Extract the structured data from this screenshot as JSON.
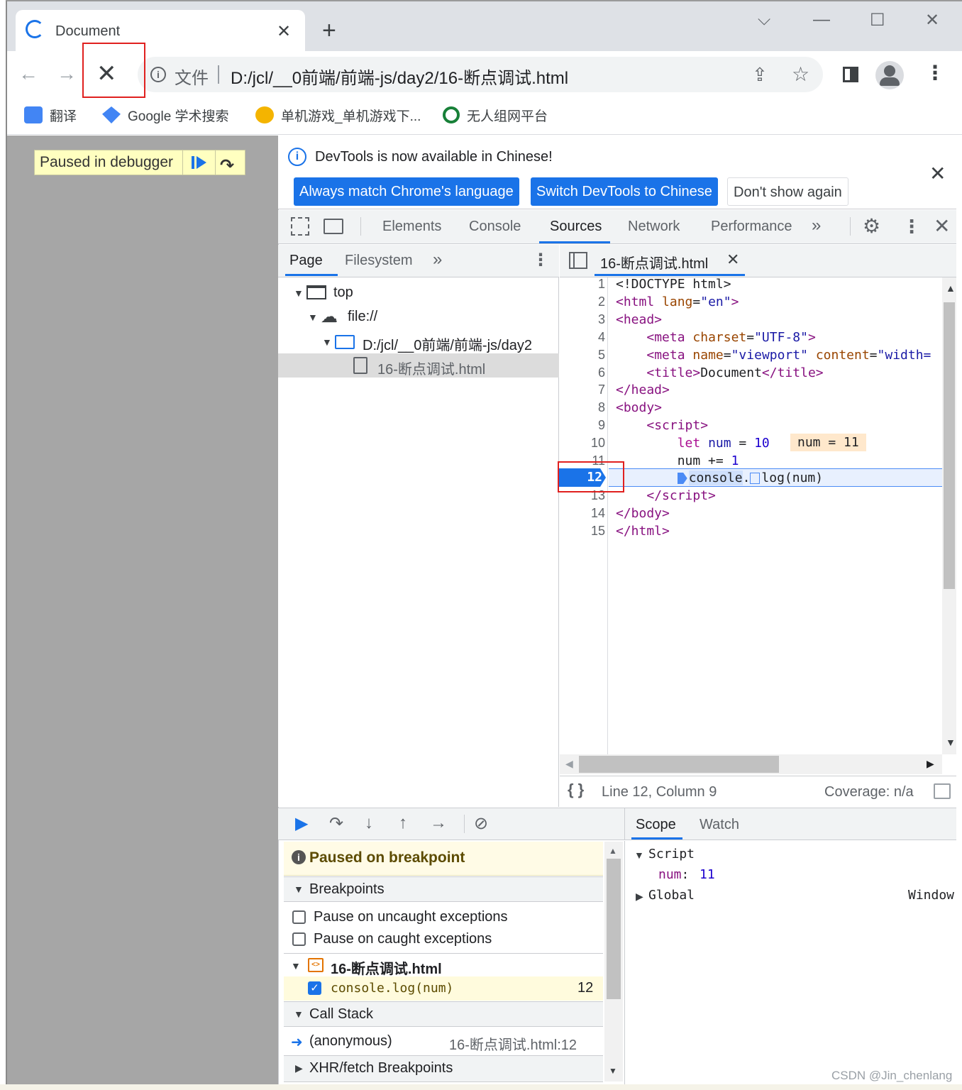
{
  "browser": {
    "tab_title": "Document",
    "address_prefix": "文件",
    "url": "D:/jcl/__0前端/前端-js/day2/16-断点调试.html",
    "bookmarks": [
      {
        "label": "翻译"
      },
      {
        "label": "Google 学术搜索"
      },
      {
        "label": "单机游戏_单机游戏下..."
      },
      {
        "label": "无人组网平台"
      }
    ]
  },
  "page": {
    "paused_overlay": "Paused in debugger"
  },
  "devtools": {
    "infobar": {
      "message": "DevTools is now available in Chinese!",
      "btn_match": "Always match Chrome's language",
      "btn_switch": "Switch DevTools to Chinese",
      "btn_dismiss": "Don't show again"
    },
    "tabs": [
      "Elements",
      "Console",
      "Sources",
      "Network",
      "Performance"
    ],
    "active_tab": "Sources",
    "navigator": {
      "tabs": [
        "Page",
        "Filesystem"
      ],
      "tree": [
        "top",
        "file://",
        "D:/jcl/__0前端/前端-js/day2",
        "16-断点调试.html"
      ]
    },
    "editor": {
      "file_tab": "16-断点调试.html",
      "line_numbers": [
        "1",
        "2",
        "3",
        "4",
        "5",
        "6",
        "7",
        "8",
        "9",
        "10",
        "11",
        "12",
        "13",
        "14",
        "15"
      ],
      "current_line": "12",
      "inline_value": "num = 11",
      "status_position": "Line 12, Column 9",
      "coverage": "Coverage: n/a"
    },
    "debugger": {
      "paused_status": "Paused on breakpoint",
      "breakpoints_title": "Breakpoints",
      "pause_uncaught": "Pause on uncaught exceptions",
      "pause_caught": "Pause on caught exceptions",
      "bp_file": "16-断点调试.html",
      "bp_code": "console.log(num)",
      "bp_line": "12",
      "callstack_title": "Call Stack",
      "frame_name": "(anonymous)",
      "frame_location": "16-断点调试.html:12",
      "xhr_title": "XHR/fetch Breakpoints"
    },
    "scope": {
      "tabs": [
        "Scope",
        "Watch"
      ],
      "script_label": "Script",
      "var_name": "num",
      "var_value": "11",
      "global_label": "Global",
      "global_value": "Window"
    }
  },
  "watermark": "CSDN @Jin_chenlang",
  "colors": {
    "accent": "#1a73e8",
    "highlight_box": "#e0201f",
    "paused_bg": "#ffffc0"
  }
}
